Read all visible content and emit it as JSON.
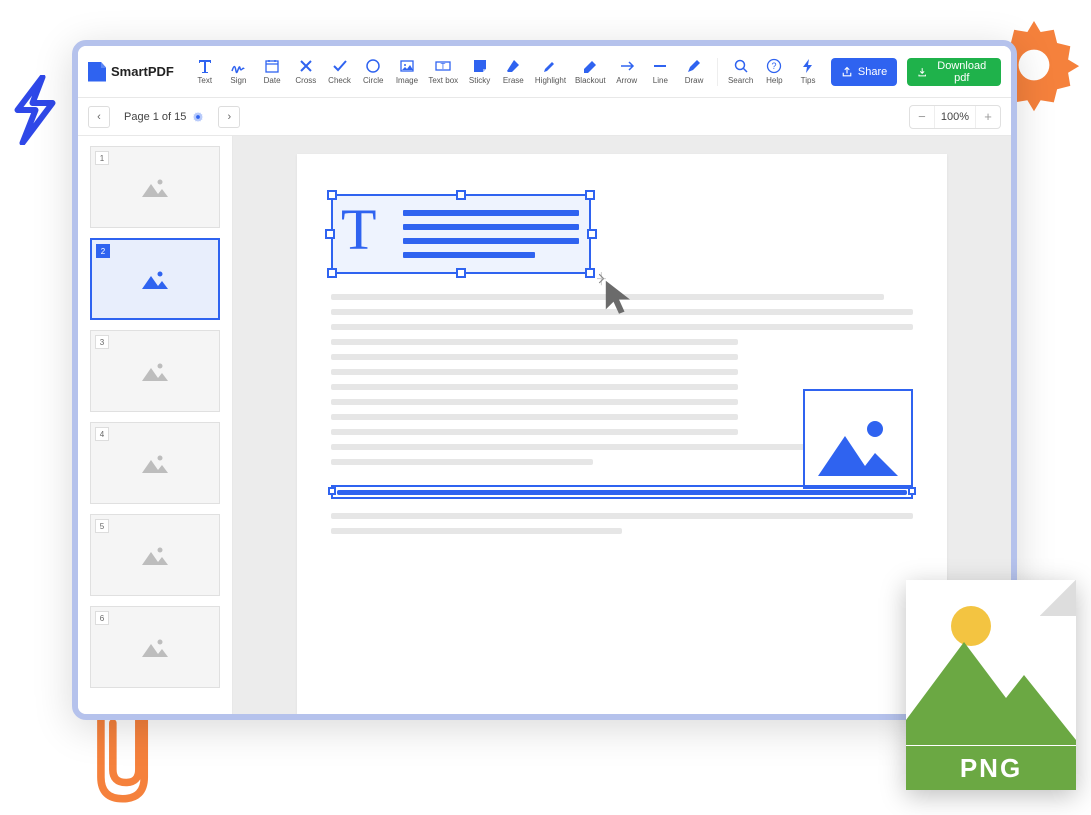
{
  "app": {
    "name": "SmartPDF"
  },
  "toolbar": {
    "items": [
      {
        "id": "text",
        "label": "Text"
      },
      {
        "id": "sign",
        "label": "Sign"
      },
      {
        "id": "date",
        "label": "Date"
      },
      {
        "id": "cross",
        "label": "Cross"
      },
      {
        "id": "check",
        "label": "Check"
      },
      {
        "id": "circle",
        "label": "Circle"
      },
      {
        "id": "image",
        "label": "Image"
      },
      {
        "id": "textbox",
        "label": "Text box"
      },
      {
        "id": "sticky",
        "label": "Sticky"
      },
      {
        "id": "erase",
        "label": "Erase"
      },
      {
        "id": "highlight",
        "label": "Highlight"
      },
      {
        "id": "blackout",
        "label": "Blackout"
      },
      {
        "id": "arrow",
        "label": "Arrow"
      },
      {
        "id": "line",
        "label": "Line"
      },
      {
        "id": "draw",
        "label": "Draw"
      }
    ],
    "right": [
      {
        "id": "search",
        "label": "Search"
      },
      {
        "id": "help",
        "label": "Help"
      },
      {
        "id": "tips",
        "label": "Tips"
      }
    ],
    "share": "Share",
    "download": "Download pdf"
  },
  "navigation": {
    "page_label": "Page 1 of 15",
    "zoom": "100%"
  },
  "thumbnails": [
    {
      "num": "1",
      "active": false
    },
    {
      "num": "2",
      "active": true
    },
    {
      "num": "3",
      "active": false
    },
    {
      "num": "4",
      "active": false
    },
    {
      "num": "5",
      "active": false
    },
    {
      "num": "6",
      "active": false
    }
  ],
  "overlay": {
    "png_label": "PNG"
  }
}
